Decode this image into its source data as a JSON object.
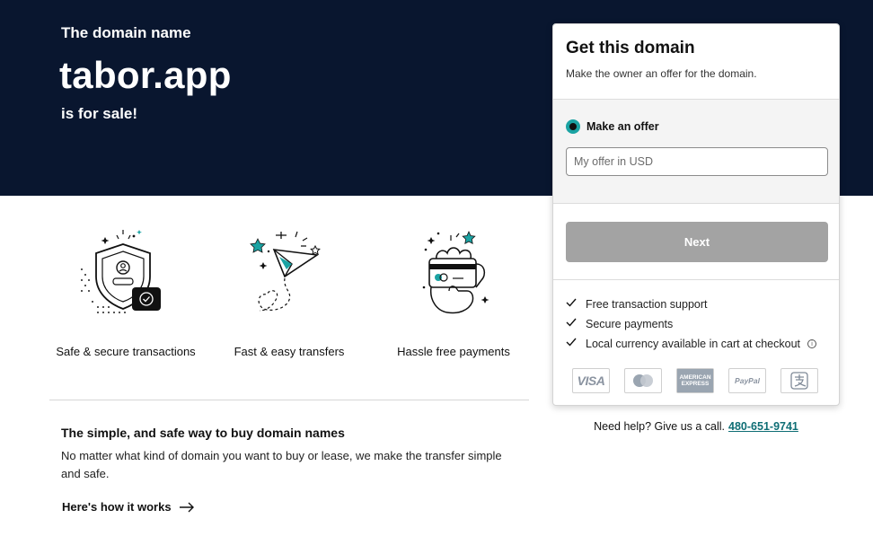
{
  "hero": {
    "pre_title": "The domain name",
    "domain": "tabor.app",
    "post_title": "is for sale!"
  },
  "features": [
    {
      "label": "Safe & secure transactions",
      "icon": "shield-icon"
    },
    {
      "label": "Fast & easy transfers",
      "icon": "paper-plane-icon"
    },
    {
      "label": "Hassle free payments",
      "icon": "hand-card-icon"
    }
  ],
  "info": {
    "title": "The simple, and safe way to buy domain names",
    "text": "No matter what kind of domain you want to buy or lease, we make the transfer simple and safe.",
    "link_label": "Here's how it works"
  },
  "panel": {
    "title": "Get this domain",
    "subtitle": "Make the owner an offer for the domain.",
    "option_label": "Make an offer",
    "input_placeholder": "My offer in USD",
    "input_value": "",
    "next_label": "Next",
    "benefits": [
      "Free transaction support",
      "Secure payments",
      "Local currency available in cart at checkout"
    ],
    "payment_methods": [
      {
        "name": "VISA",
        "icon": "visa-icon"
      },
      {
        "name": "Mastercard",
        "icon": "mastercard-icon"
      },
      {
        "name": "AMERICAN EXPRESS",
        "icon": "amex-icon"
      },
      {
        "name": "PayPal",
        "icon": "paypal-icon"
      },
      {
        "name": "Alipay",
        "icon": "alipay-icon"
      }
    ]
  },
  "help": {
    "text": "Need help? Give us a call.",
    "phone": "480-651-9741"
  },
  "colors": {
    "hero_bg": "#09162f",
    "accent_teal": "#1ba3a3",
    "link": "#0f6e75",
    "button_disabled": "#a3a3a3"
  }
}
